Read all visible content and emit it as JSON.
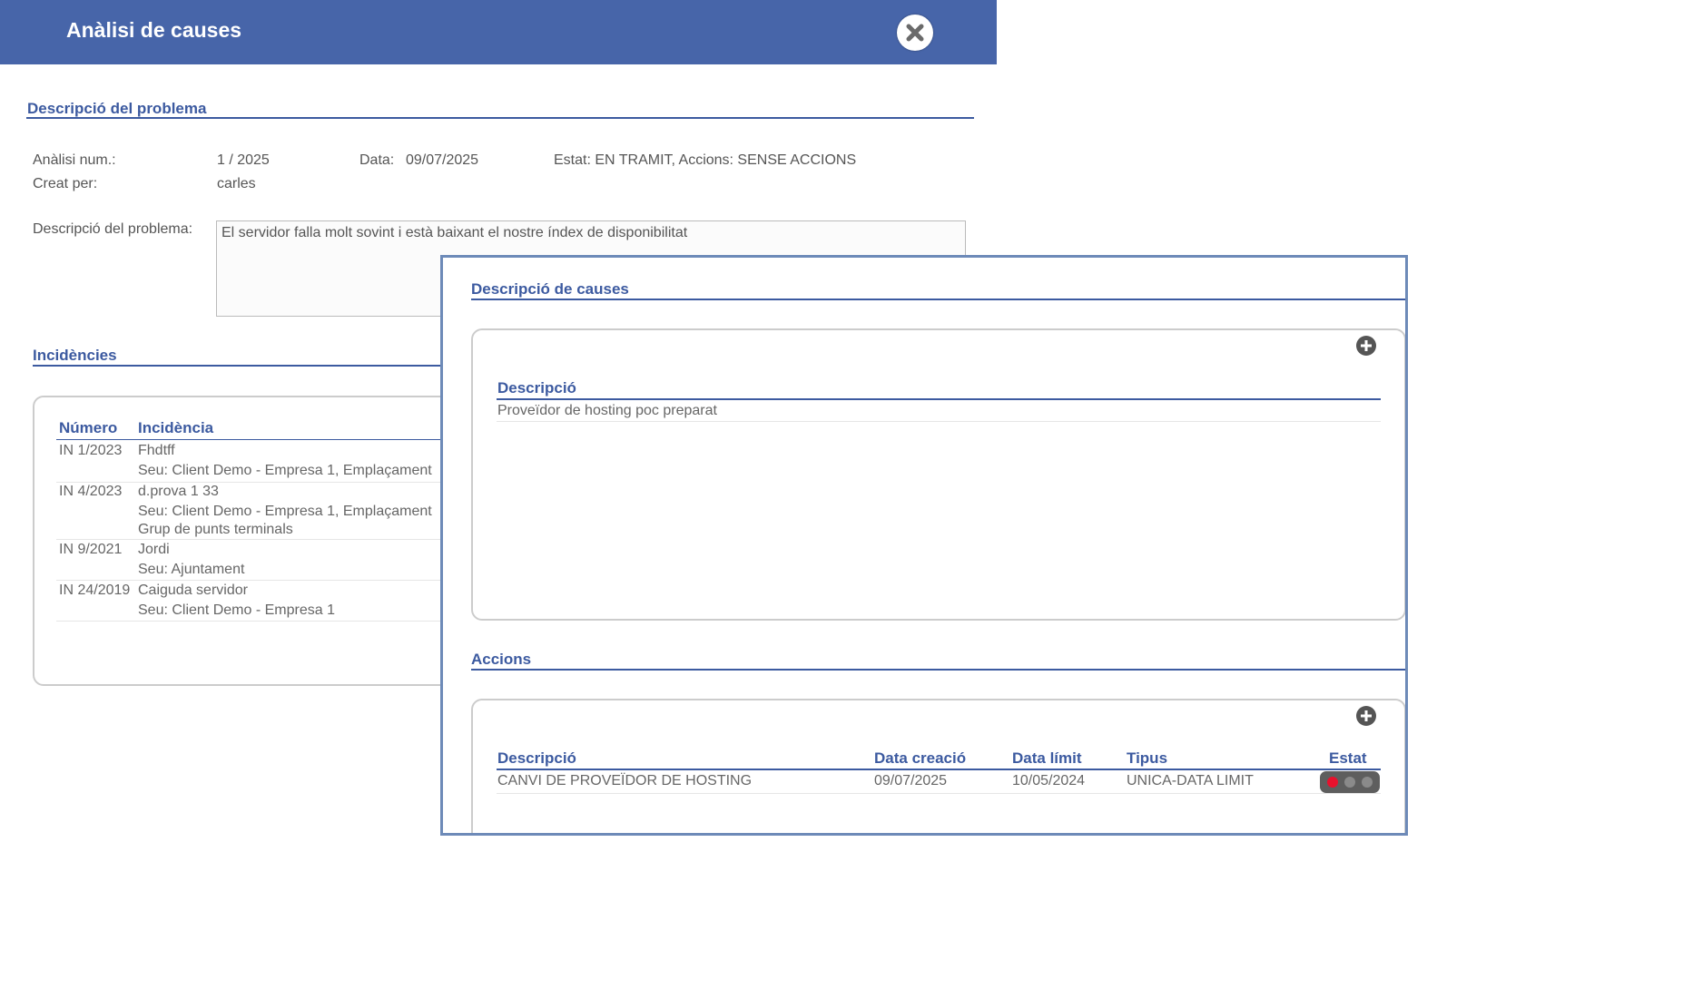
{
  "header": {
    "title": "Anàlisi de causes"
  },
  "problem": {
    "section_title": "Descripció del problema",
    "num_label": "Anàlisi num.:",
    "num_value": "1 / 2025",
    "date_label": "Data:",
    "date_value": "09/07/2025",
    "status_text": "Estat: EN TRAMIT, Accions: SENSE ACCIONS",
    "created_label": "Creat per:",
    "created_value": "carles",
    "desc_label": "Descripció del problema:",
    "desc_value": "El servidor falla molt sovint i està baixant el nostre índex de disponibilitat"
  },
  "incidents": {
    "section_title": "Incidències",
    "headers": {
      "number": "Número",
      "incident": "Incidència"
    },
    "rows": [
      {
        "number": "IN 1/2023",
        "title": "Fhdtff",
        "lines": [
          "Seu: Client Demo - Empresa 1, Emplaçament"
        ]
      },
      {
        "number": "IN 4/2023",
        "title": "d.prova 1 33",
        "lines": [
          "Seu: Client Demo - Empresa 1, Emplaçament",
          "Grup de punts terminals"
        ]
      },
      {
        "number": "IN 9/2021",
        "title": "Jordi",
        "lines": [
          "Seu: Ajuntament"
        ]
      },
      {
        "number": "IN 24/2019",
        "title": "Caiguda servidor",
        "lines": [
          "Seu: Client Demo - Empresa 1"
        ]
      }
    ]
  },
  "causes": {
    "section_title": "Descripció de causes",
    "header": "Descripció",
    "rows": [
      "Proveïdor de hosting poc preparat"
    ]
  },
  "actions": {
    "section_title": "Accions",
    "headers": {
      "desc": "Descripció",
      "created": "Data creació",
      "limit": "Data límit",
      "type": "Tipus",
      "status": "Estat"
    },
    "rows": [
      {
        "desc": "CANVI DE PROVEÏDOR DE HOSTING",
        "created": "09/07/2025",
        "limit": "10/05/2024",
        "type": "UNICA-DATA LIMIT",
        "status_color": "#e8112d"
      }
    ]
  },
  "colors": {
    "brand": "#4765a9",
    "heading": "#3c5aa0",
    "status_red": "#e8112d",
    "status_off": "#8a8a8a"
  },
  "icons": {
    "close": "close-icon",
    "add": "plus-circle-icon"
  }
}
